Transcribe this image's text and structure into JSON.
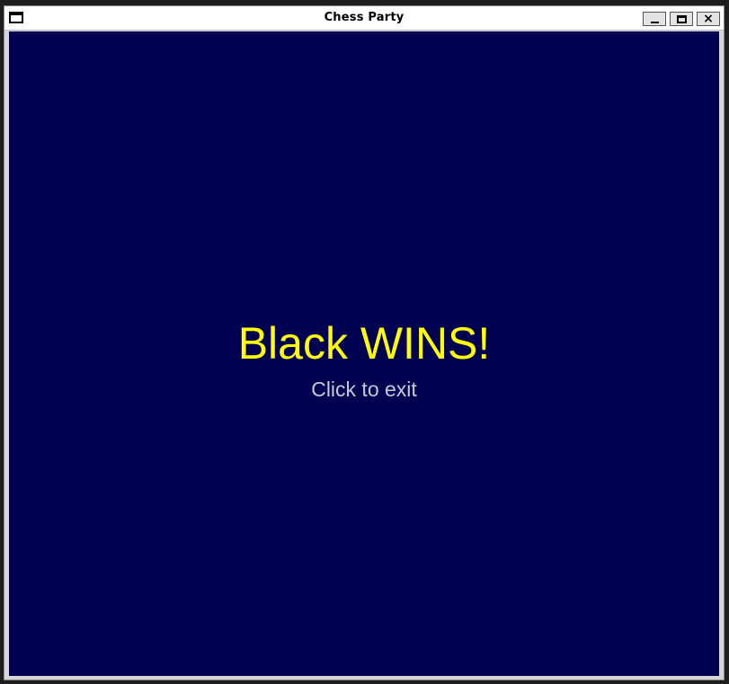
{
  "window": {
    "title": "Chess Party",
    "controls": {
      "minimize_icon": "minimize-icon",
      "maximize_icon": "maximize-icon",
      "close_icon": "close-icon",
      "close_glyph": "×"
    }
  },
  "game": {
    "result_text": "Black WINS!",
    "hint_text": "Click to exit"
  },
  "colors": {
    "background": "#000050",
    "result_text": "#ffff00",
    "hint_text": "#c8c8d8"
  }
}
